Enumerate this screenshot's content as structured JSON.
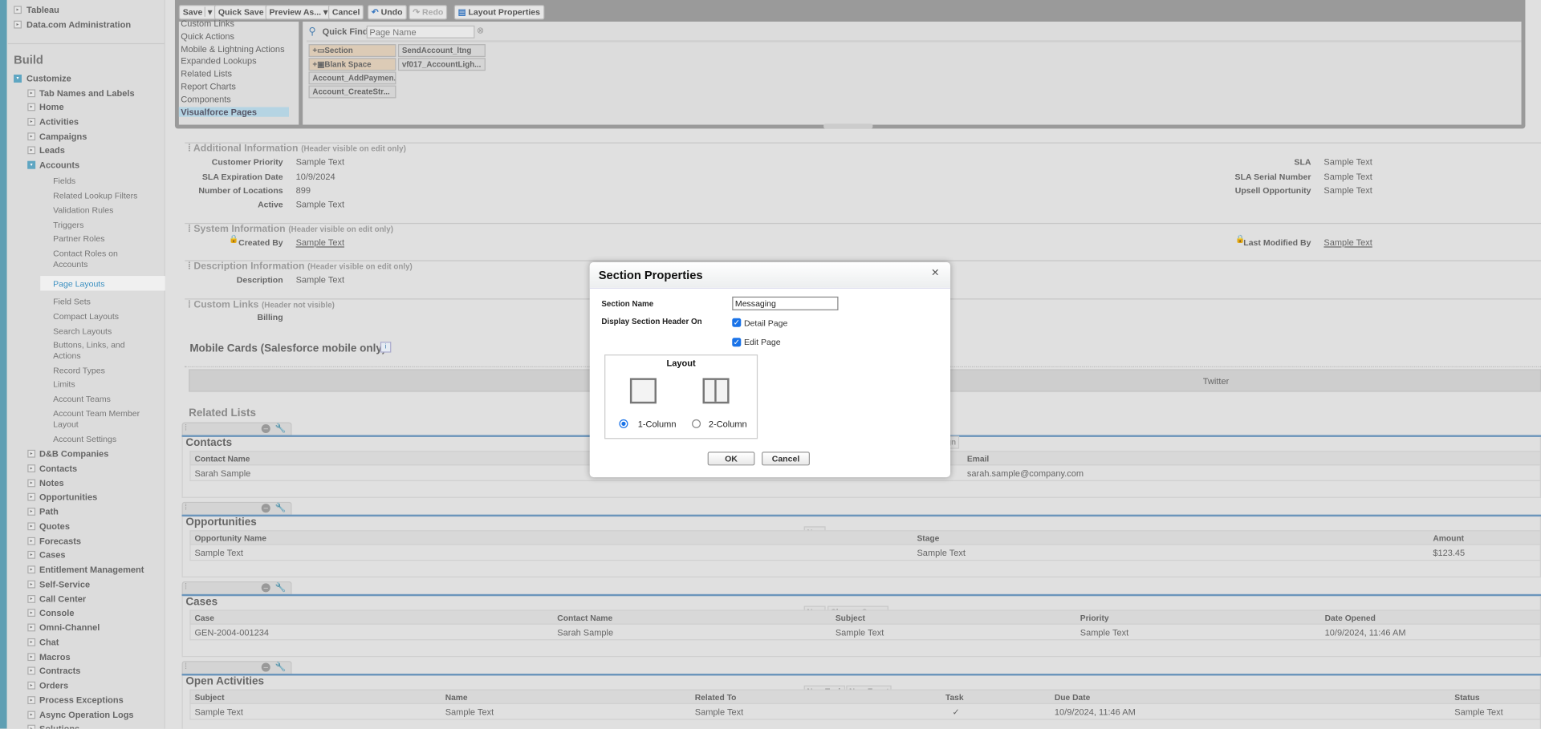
{
  "sidebar": {
    "top_items": [
      "Tableau",
      "Data.com Administration"
    ],
    "section": "Build",
    "customize": "Customize",
    "customize_items_before": [
      "Tab Names and Labels",
      "Home",
      "Activities",
      "Campaigns",
      "Leads"
    ],
    "accounts": "Accounts",
    "account_items": [
      "Fields",
      "Related Lookup Filters",
      "Validation Rules",
      "Triggers",
      "Partner Roles",
      "Contact Roles on Accounts",
      "Page Layouts",
      "Field Sets",
      "Compact Layouts",
      "Search Layouts",
      "Buttons, Links, and Actions",
      "Record Types",
      "Limits",
      "Account Teams",
      "Account Team Member Layout",
      "Account Settings"
    ],
    "selected": "Page Layouts",
    "customize_items_after": [
      "D&B Companies",
      "Contacts",
      "Notes",
      "Opportunities",
      "Path",
      "Quotes",
      "Forecasts",
      "Cases",
      "Entitlement Management",
      "Self-Service",
      "Call Center",
      "Console",
      "Omni-Channel",
      "Chat",
      "Macros",
      "Contracts",
      "Orders",
      "Process Exceptions",
      "Async Operation Logs",
      "Solutions"
    ]
  },
  "toolbar": {
    "save": "Save",
    "quick_save": "Quick Save",
    "preview_as": "Preview As...",
    "cancel": "Cancel",
    "undo": "Undo",
    "redo": "Redo",
    "layout_properties": "Layout Properties"
  },
  "palette": {
    "categories": [
      "Custom Links",
      "Quick Actions",
      "Mobile & Lightning Actions",
      "Expanded Lookups",
      "Related Lists",
      "Report Charts",
      "Components",
      "Visualforce Pages"
    ],
    "selected_category": "Visualforce Pages",
    "quick_find_label": "Quick Find",
    "quick_find_placeholder": "Page Name",
    "items": [
      "Section",
      "SendAccount_ltng",
      "Blank Space",
      "vf017_AccountLigh...",
      "Account_AddPaymen...",
      "Account_CreateStr..."
    ]
  },
  "sections": [
    {
      "title": "Additional Information",
      "note": "(Header visible on edit only)",
      "left": [
        [
          "Customer Priority",
          "Sample Text"
        ],
        [
          "SLA Expiration Date",
          "10/9/2024"
        ],
        [
          "Number of Locations",
          "899"
        ],
        [
          "Active",
          "Sample Text"
        ]
      ],
      "right": [
        [
          "SLA",
          "Sample Text"
        ],
        [
          "SLA Serial Number",
          "Sample Text"
        ],
        [
          "Upsell Opportunity",
          "Sample Text"
        ]
      ]
    },
    {
      "title": "System Information",
      "note": "(Header visible on edit only)",
      "left": [
        [
          "Created By",
          "Sample Text"
        ]
      ],
      "right": [
        [
          "Last Modified By",
          "Sample Text"
        ]
      ]
    },
    {
      "title": "Description Information",
      "note": "(Header visible on edit only)",
      "left": [
        [
          "Description",
          "Sample Text"
        ]
      ]
    },
    {
      "title": "Custom Links",
      "note": "(Header not visible)",
      "left": [
        [
          "Billing",
          ""
        ]
      ]
    }
  ],
  "mobile_cards": {
    "title": "Mobile Cards (Salesforce mobile only)",
    "card": "Twitter"
  },
  "related_lists": {
    "title": "Related Lists",
    "contacts": {
      "title": "Contacts",
      "button_partial": "gn",
      "headers": [
        "Contact Name",
        "Email"
      ],
      "row": [
        "Sarah Sample",
        "sarah.sample@company.com"
      ]
    },
    "opportunities": {
      "title": "Opportunities",
      "buttons": [
        "New"
      ],
      "headers": [
        "Opportunity Name",
        "Stage",
        "Amount"
      ],
      "row": [
        "Sample Text",
        "Sample Text",
        "$123.45"
      ]
    },
    "cases": {
      "title": "Cases",
      "buttons": [
        "New",
        "Change Owner"
      ],
      "headers": [
        "Case",
        "Contact Name",
        "Subject",
        "Priority",
        "Date Opened"
      ],
      "row": [
        "GEN-2004-001234",
        "Sarah Sample",
        "Sample Text",
        "Sample Text",
        "10/9/2024, 11:46 AM"
      ]
    },
    "activities": {
      "title": "Open Activities",
      "buttons": [
        "New Task",
        "New Event"
      ],
      "headers": [
        "Subject",
        "Name",
        "Related To",
        "Task",
        "Due Date",
        "Status"
      ],
      "row": [
        "Sample Text",
        "Sample Text",
        "Sample Text",
        "✓",
        "10/9/2024, 11:46 AM",
        "Sample Text"
      ]
    }
  },
  "dialog": {
    "title": "Section Properties",
    "section_name_label": "Section Name",
    "section_name_value": "Messaging",
    "display_label": "Display Section Header On",
    "detail_page": "Detail Page",
    "edit_page": "Edit Page",
    "detail_checked": true,
    "edit_checked": true,
    "layout_label": "Layout",
    "one_col": "1-Column",
    "two_col": "2-Column",
    "selected_layout": "1-Column",
    "ok": "OK",
    "cancel": "Cancel"
  },
  "colors": {
    "accent": "#5f9fb3",
    "link_blue": "#1a73e8",
    "related_line": "#6b95bb"
  }
}
